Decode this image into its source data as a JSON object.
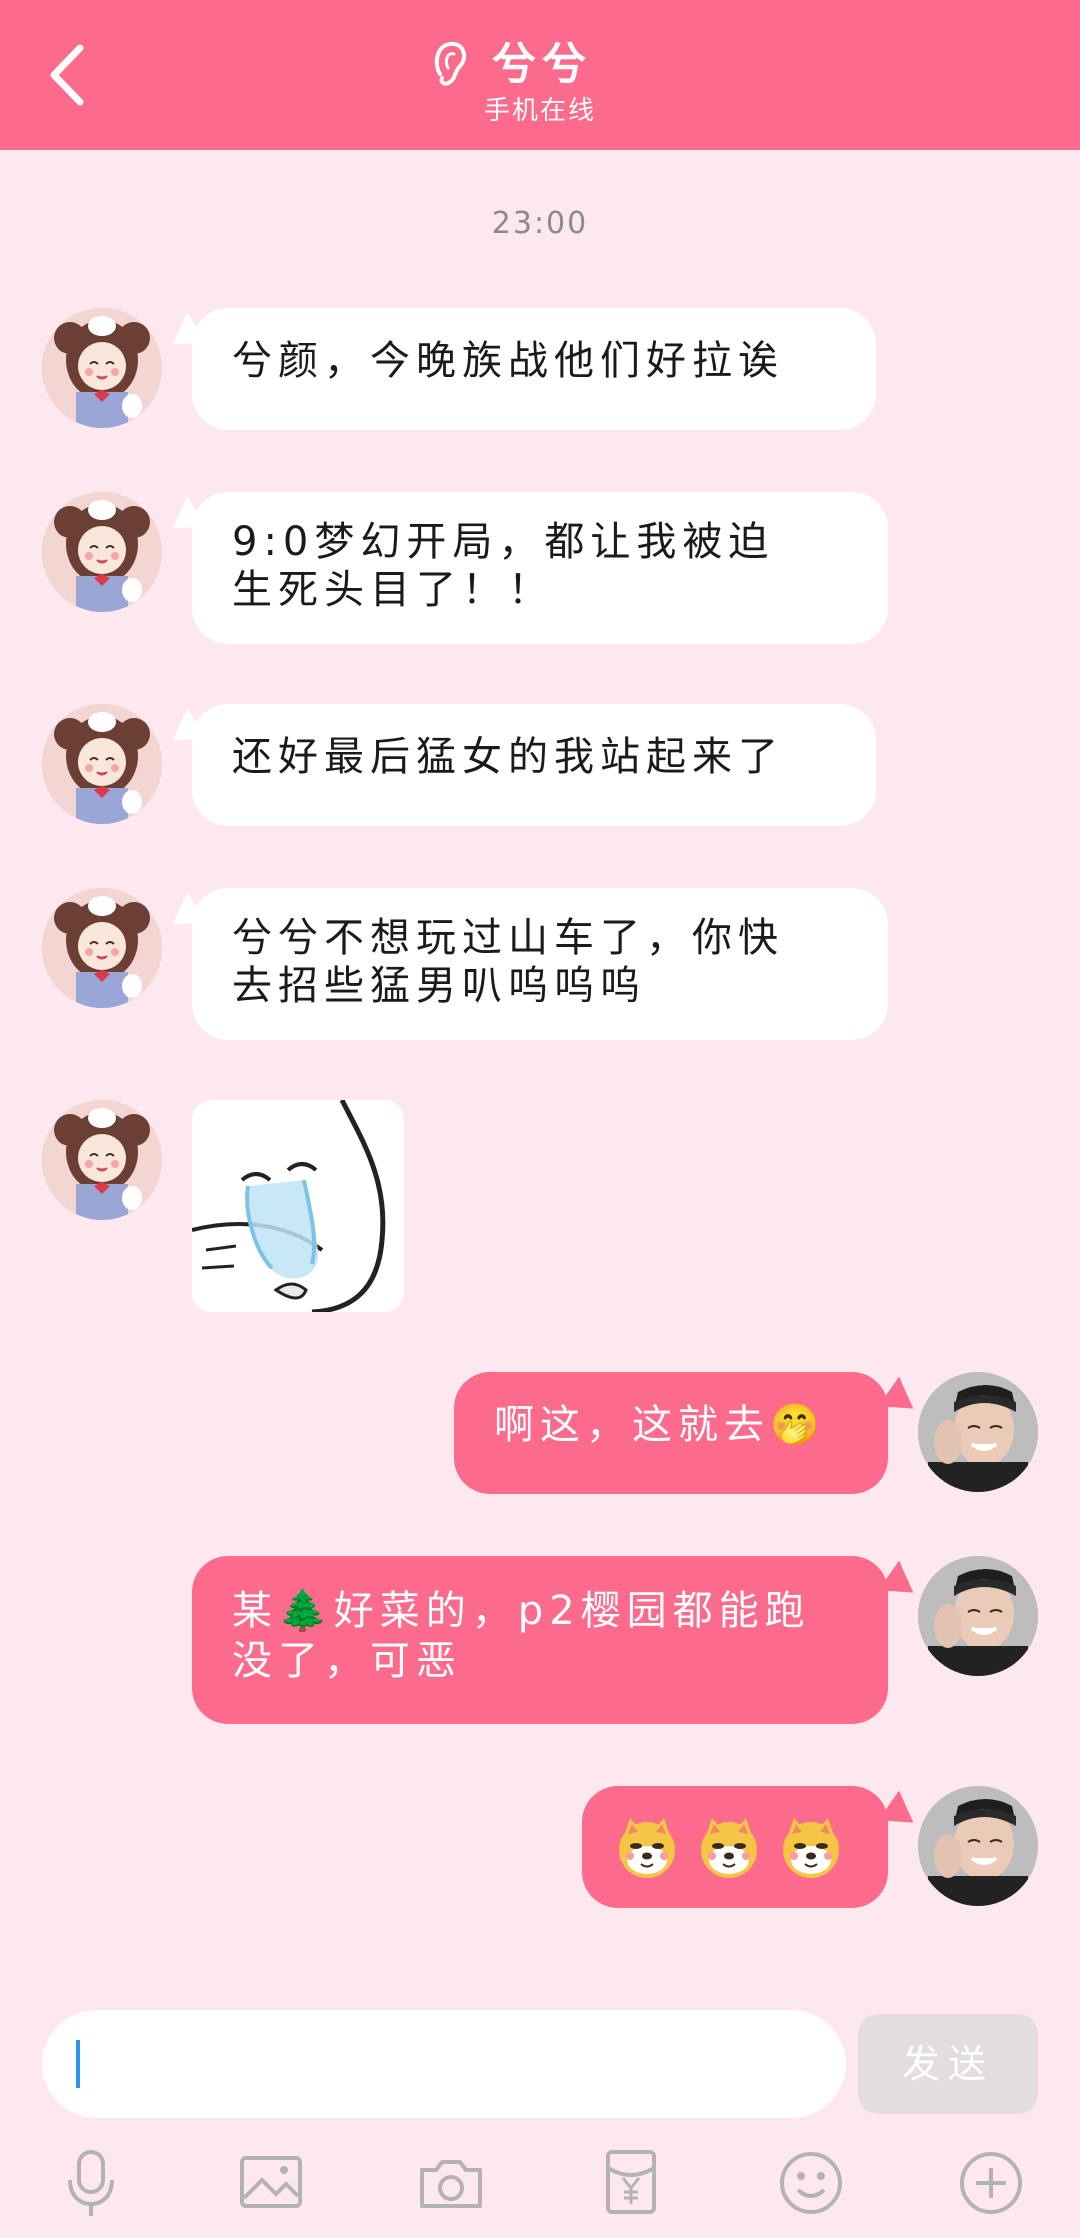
{
  "header": {
    "title": "兮兮",
    "subtitle": "手机在线",
    "back_icon": "chevron-left-icon",
    "status_icon": "ear-icon",
    "bg_color": "#fc6a8c"
  },
  "timestamp": "23:00",
  "messages": [
    {
      "from": "other",
      "text": "兮颜，今晚族战他们好拉诶"
    },
    {
      "from": "other",
      "line1": "9:0梦幻开局，都让我被迫",
      "line2": "生死头目了！！"
    },
    {
      "from": "other",
      "text": "还好最后猛女的我站起来了"
    },
    {
      "from": "other",
      "line1": "兮兮不想玩过山车了，你快",
      "line2": "去招些猛男叭呜呜呜"
    },
    {
      "from": "other",
      "type": "sticker",
      "icon": "crying-cat-sticker"
    },
    {
      "from": "me",
      "text": "啊这，这就去🤭"
    },
    {
      "from": "me",
      "line1": "某🌲好菜的，p2樱园都能跑",
      "line2": "没了，可恶"
    },
    {
      "from": "me",
      "type": "emoji-row",
      "icon": "doge-emoji",
      "count": 3
    }
  ],
  "composer": {
    "input_value": "",
    "send_label": "发送",
    "tools": [
      "microphone-icon",
      "image-icon",
      "camera-icon",
      "red-packet-icon",
      "emoji-icon",
      "plus-icon"
    ]
  }
}
